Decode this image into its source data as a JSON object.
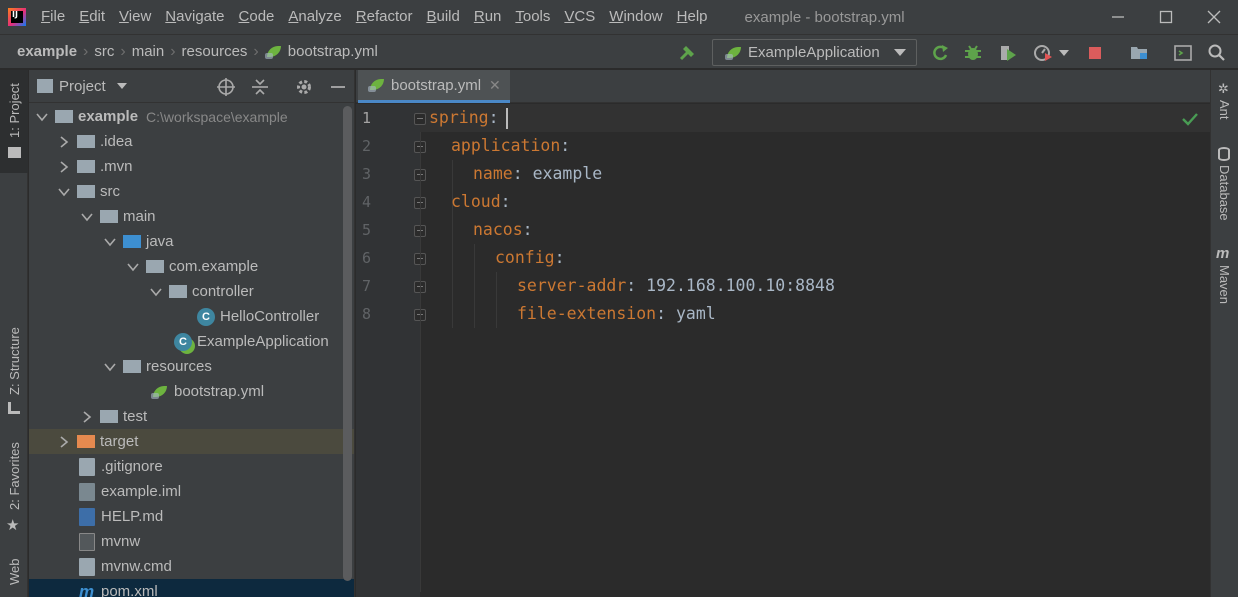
{
  "menu": {
    "items": [
      "File",
      "Edit",
      "View",
      "Navigate",
      "Code",
      "Analyze",
      "Refactor",
      "Build",
      "Run",
      "Tools",
      "VCS",
      "Window",
      "Help"
    ],
    "window_title": "example - bootstrap.yml"
  },
  "breadcrumb": [
    "example",
    "src",
    "main",
    "resources",
    "bootstrap.yml"
  ],
  "run_config": {
    "label": "ExampleApplication"
  },
  "left_tabs": {
    "project": "1: Project",
    "structure": "Z: Structure",
    "favorites": "2: Favorites",
    "web": "Web"
  },
  "project_panel": {
    "title": "Project",
    "tree": [
      {
        "label": "example",
        "hint": "C:\\workspace\\example"
      },
      {
        "label": ".idea"
      },
      {
        "label": ".mvn"
      },
      {
        "label": "src"
      },
      {
        "label": "main"
      },
      {
        "label": "java"
      },
      {
        "label": "com.example"
      },
      {
        "label": "controller"
      },
      {
        "label": "HelloController"
      },
      {
        "label": "ExampleApplication"
      },
      {
        "label": "resources"
      },
      {
        "label": "bootstrap.yml"
      },
      {
        "label": "test"
      },
      {
        "label": "target"
      },
      {
        "label": ".gitignore"
      },
      {
        "label": "example.iml"
      },
      {
        "label": "HELP.md"
      },
      {
        "label": "mvnw"
      },
      {
        "label": "mvnw.cmd"
      },
      {
        "label": "pom.xml"
      }
    ]
  },
  "editor": {
    "tab": "bootstrap.yml",
    "line_numbers": [
      "1",
      "2",
      "3",
      "4",
      "5",
      "6",
      "7",
      "8"
    ],
    "lines": [
      {
        "key": "spring",
        "sep": ":",
        "value": ""
      },
      {
        "key": "application",
        "sep": ":",
        "value": ""
      },
      {
        "key": "name",
        "sep": ":",
        "value": " example"
      },
      {
        "key": "cloud",
        "sep": ":",
        "value": ""
      },
      {
        "key": "nacos",
        "sep": ":",
        "value": ""
      },
      {
        "key": "config",
        "sep": ":",
        "value": ""
      },
      {
        "key": "server-addr",
        "sep": ":",
        "value": " 192.168.100.10:8848"
      },
      {
        "key": "file-extension",
        "sep": ":",
        "value": " yaml"
      }
    ]
  },
  "right_tabs": {
    "ant": "Ant",
    "database": "Database",
    "maven": "Maven"
  },
  "colors": {
    "yaml_key": "#cc7832",
    "yaml_value": "#a9b7c6",
    "accent": "#4a88c7",
    "spring": "#6db33f"
  }
}
